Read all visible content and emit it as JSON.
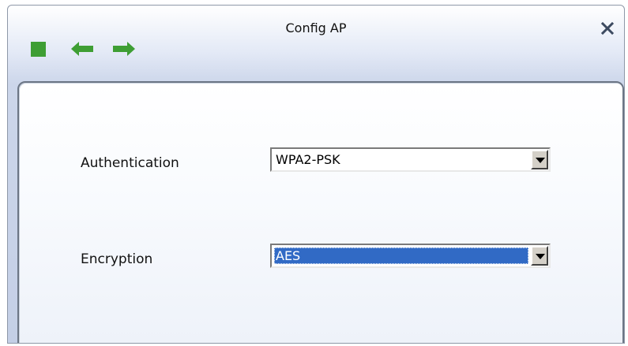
{
  "window": {
    "title": "Config AP"
  },
  "toolbar": {
    "icons": [
      "stop-icon",
      "back-arrow-icon",
      "forward-arrow-icon"
    ],
    "icon_color": "#3e9e34"
  },
  "form": {
    "authentication": {
      "label": "Authentication",
      "value": "WPA2-PSK"
    },
    "encryption": {
      "label": "Encryption",
      "value": "AES"
    }
  },
  "colors": {
    "selection": "#316ac5",
    "close_icon": "#3c4a60"
  }
}
